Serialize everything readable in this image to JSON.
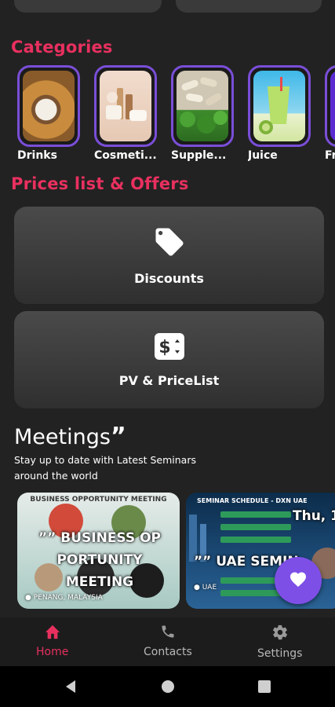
{
  "colors": {
    "accent": "#e8305f",
    "purple": "#7e4fe6",
    "background": "#222222"
  },
  "categories": {
    "title": "Categories",
    "items": [
      {
        "label": "Drinks"
      },
      {
        "label": "Cosmeti..."
      },
      {
        "label": "Supple..."
      },
      {
        "label": "Juice"
      },
      {
        "label": "Fr"
      }
    ]
  },
  "offers": {
    "title": "Prices list & Offers",
    "cards": [
      {
        "label": "Discounts",
        "icon": "tag-icon"
      },
      {
        "label": "PV & PriceList",
        "icon": "price-icon"
      }
    ]
  },
  "meetings": {
    "title": "Meetings",
    "subtitle": "Stay up to date with Latest Seminars around the world",
    "cards": [
      {
        "header": "BUSINESS OPPORTUNITY MEETING",
        "title_line1": "BUSINESS OP",
        "title_line2": "PORTUNITY",
        "title_line3": "MEETING",
        "location": "PENANG, MALAYSIA"
      },
      {
        "header": "SEMINAR SCHEDULE - DXN UAE",
        "title": "UAE SEMIN",
        "date": "Thu, 1",
        "location": "UAE"
      }
    ]
  },
  "bottom_nav": {
    "items": [
      {
        "label": "Home",
        "icon": "home-icon",
        "active": true
      },
      {
        "label": "Contacts",
        "icon": "phone-icon",
        "active": false
      },
      {
        "label": "Settings",
        "icon": "gear-icon",
        "active": false
      }
    ]
  }
}
